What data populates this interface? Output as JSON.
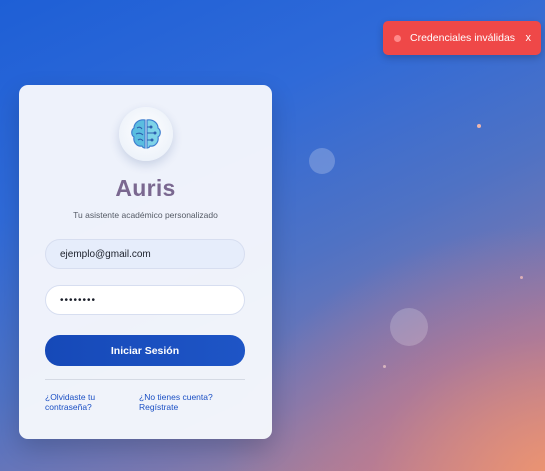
{
  "toast": {
    "message": "Credenciales inválidas",
    "close_label": "x",
    "color": "#ef4848"
  },
  "login": {
    "brand": "Auris",
    "tagline": "Tu asistente académico personalizado",
    "email_value": "ejemplo@gmail.com",
    "password_value": "12345678",
    "submit_label": "Iniciar Sesión",
    "forgot_label": "¿Olvidaste tu contraseña?",
    "signup_label": "¿No tienes cuenta? Regístrate",
    "logo_icon": "brain-icon"
  },
  "colors": {
    "primary": "#1649b8",
    "brand_text": "#7a6890",
    "link": "#1a4fc4"
  }
}
